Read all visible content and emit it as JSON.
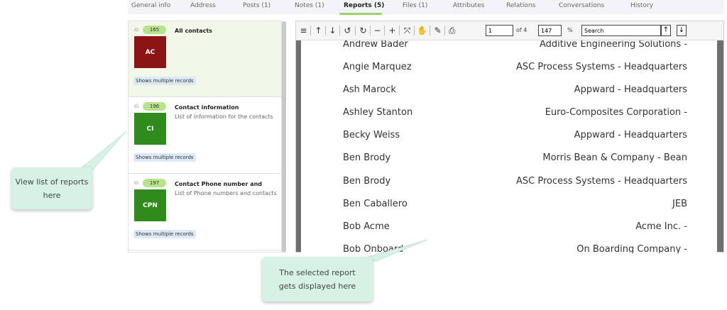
{
  "tabs": [
    {
      "label": "General info"
    },
    {
      "label": "Address"
    },
    {
      "label": "Posts (1)"
    },
    {
      "label": "Notes (1)"
    },
    {
      "label": "Reports (5)"
    },
    {
      "label": "Files (1)"
    },
    {
      "label": "Attributes"
    },
    {
      "label": "Relations"
    },
    {
      "label": "Conversations"
    },
    {
      "label": "History"
    }
  ],
  "active_tab": "Reports (5)",
  "reports": {
    "id_label": "ID",
    "items": [
      {
        "id": "165",
        "title": "All contacts",
        "description": "",
        "icon_text": "AC",
        "icon_color": "#8b1414",
        "tag": "Shows multiple records"
      },
      {
        "id": "196",
        "title": "Contact information",
        "description": "List of information for the contacts",
        "icon_text": "CI",
        "icon_color": "#2e8b1c",
        "tag": "Shows multiple records"
      },
      {
        "id": "197",
        "title": "Contact Phone number and",
        "description": "List of Phone numbers and contacts",
        "icon_text": "CPN",
        "icon_color": "#2e8b1c",
        "tag": "Shows multiple records"
      }
    ]
  },
  "viewer": {
    "page_current": "1",
    "page_total_label": "of 4",
    "zoom": "147",
    "zoom_unit": "%",
    "search_value": "Search",
    "icons": [
      "menu-icon",
      "arrow-up-icon",
      "arrow-down-icon",
      "rotate-ccw-icon",
      "rotate-cw-icon",
      "zoom-out-icon",
      "zoom-in-icon",
      "fit-icon",
      "hand-icon",
      "pen-icon",
      "print-icon"
    ],
    "rows": [
      {
        "name": "Andrew Bader",
        "company": "Additive Engineering Solutions -"
      },
      {
        "name": "Angie Marquez",
        "company": "ASC Process Systems - Headquarters"
      },
      {
        "name": "Ash Marock",
        "company": "Appward - Headquarters"
      },
      {
        "name": "Ashley Stanton",
        "company": "Euro-Composites Corporation -"
      },
      {
        "name": "Becky Weiss",
        "company": "Appward - Headquarters"
      },
      {
        "name": "Ben Brody",
        "company": "Morris Bean & Company - Bean"
      },
      {
        "name": "Ben Brody",
        "company": "ASC Process Systems - Headquarters"
      },
      {
        "name": "Ben Caballero",
        "company": "JEB"
      },
      {
        "name": "Bob Acme",
        "company": "Acme Inc. -"
      },
      {
        "name": "Bob Onboard",
        "company": "On Boarding Company -"
      }
    ]
  },
  "callouts": {
    "list": "View list of reports here",
    "report": "The selected report gets displayed here",
    "color": "#d6f2e5"
  }
}
